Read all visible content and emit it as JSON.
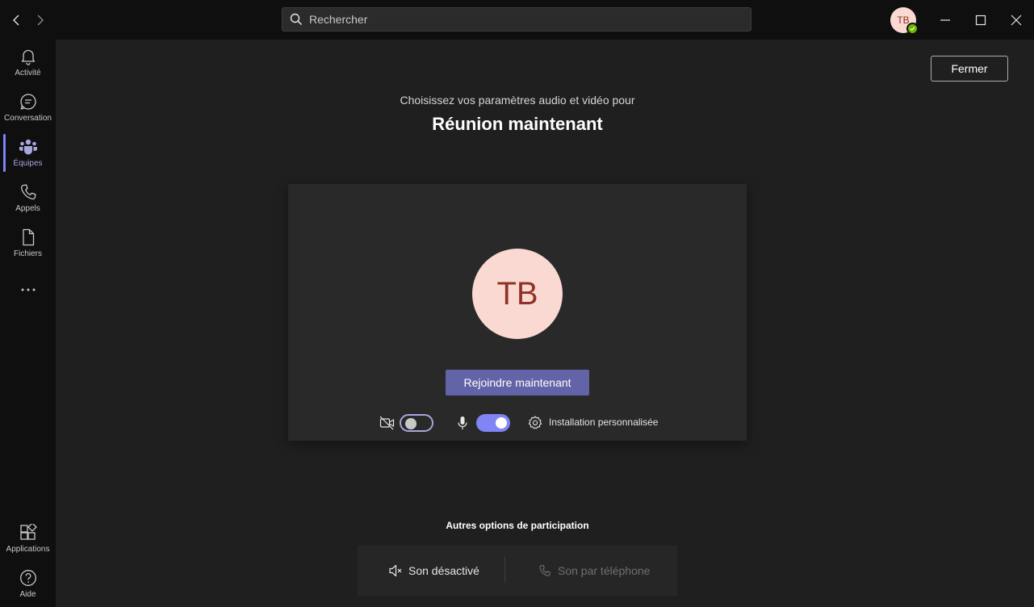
{
  "titlebar": {
    "search_placeholder": "Rechercher",
    "user_initials": "TB",
    "presence_color": "#6bb700"
  },
  "rail": {
    "items": [
      {
        "label": "Activité",
        "icon": "bell-icon"
      },
      {
        "label": "Conversation",
        "icon": "chat-icon"
      },
      {
        "label": "Équipes",
        "icon": "teams-icon",
        "active": true
      },
      {
        "label": "Appels",
        "icon": "phone-icon"
      },
      {
        "label": "Fichiers",
        "icon": "file-icon"
      }
    ],
    "more_icon": "more-icon",
    "bottom": [
      {
        "label": "Applications",
        "icon": "apps-icon"
      },
      {
        "label": "Aide",
        "icon": "help-icon"
      }
    ]
  },
  "main": {
    "close_label": "Fermer",
    "subtitle": "Choisissez vos paramètres audio et vidéo pour",
    "meeting_title": "Réunion maintenant",
    "avatar_initials": "TB",
    "join_label": "Rejoindre maintenant",
    "camera_on": false,
    "mic_on": true,
    "custom_setup_label": "Installation personnalisée",
    "other_options_title": "Autres options de participation",
    "option_audio_off": "Son désactivé",
    "option_phone_audio": "Son par téléphone"
  },
  "colors": {
    "accent": "#6264a7",
    "accent_light": "#7f85f5",
    "avatar_bg": "#fbd9d3",
    "avatar_fg": "#8e3225"
  }
}
